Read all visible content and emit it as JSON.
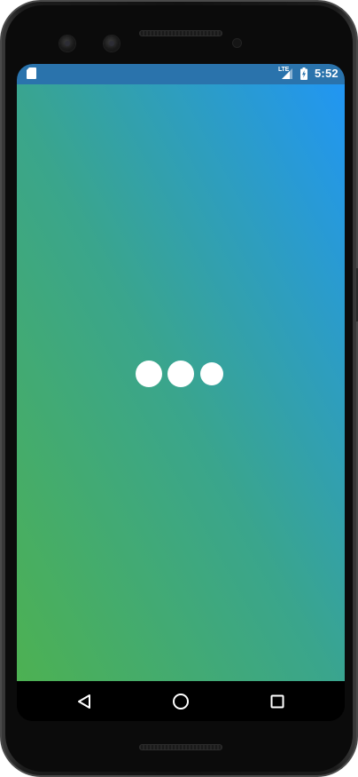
{
  "status_bar": {
    "storage_icon": "sd-card-icon",
    "network_type": "LTE",
    "signal_icon": "cell-signal-icon",
    "battery_icon": "battery-charging-icon",
    "time": "5:52",
    "background_color": "#2a73ac"
  },
  "main": {
    "background_gradient": [
      "#4db152",
      "#2196f3"
    ],
    "loading_indicator": {
      "type": "three-dot-loader",
      "dot_color": "#ffffff",
      "dots": 3
    }
  },
  "navigation_bar": {
    "buttons": [
      {
        "name": "back",
        "icon": "triangle-back-icon"
      },
      {
        "name": "home",
        "icon": "circle-home-icon"
      },
      {
        "name": "recents",
        "icon": "square-recents-icon"
      }
    ]
  }
}
